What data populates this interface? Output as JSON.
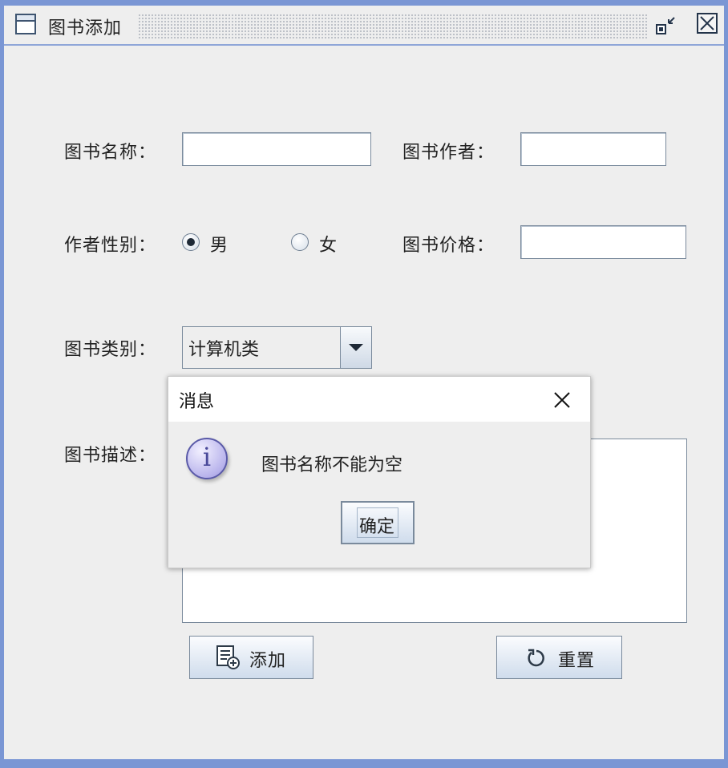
{
  "window": {
    "title": "图书添加",
    "icon": "window-icon",
    "controls": [
      "restore-icon",
      "close-icon"
    ]
  },
  "form": {
    "book_name_label": "图书名称：",
    "book_name_value": "",
    "book_author_label": "图书作者：",
    "book_author_value": "",
    "gender_label": "作者性别：",
    "gender_options": [
      {
        "label": "男",
        "selected": true
      },
      {
        "label": "女",
        "selected": false
      }
    ],
    "book_price_label": "图书价格：",
    "book_price_value": "",
    "book_type_label": "图书类别：",
    "book_type_selected": "计算机类",
    "book_desc_label": "图书描述：",
    "book_desc_value": ""
  },
  "buttons": {
    "add_label": "添加",
    "add_icon": "add-record-icon",
    "reset_label": "重置",
    "reset_icon": "refresh-icon"
  },
  "dialog": {
    "title": "消息",
    "icon": "info-icon",
    "message": "图书名称不能为空",
    "ok_label": "确定"
  },
  "colors": {
    "frame": "#7a96d4",
    "panel": "#eeeeee",
    "dialog_header": "#ffffff",
    "info_icon": "#b9b4ec"
  }
}
